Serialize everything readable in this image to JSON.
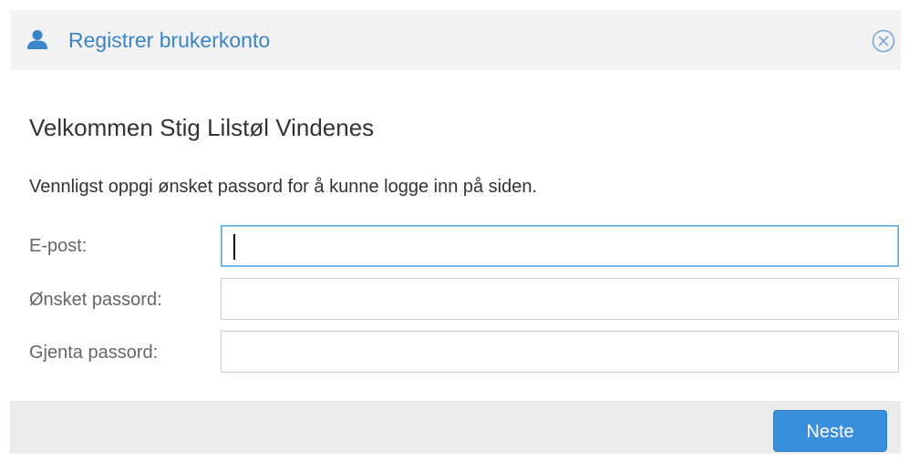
{
  "dialog": {
    "title": "Registrer brukerkonto",
    "title_icon": "user-icon",
    "close_icon": "close-circle-icon"
  },
  "main": {
    "welcome": "Velkommen Stig Lilstøl Vindenes",
    "instructions": "Vennligst oppgi ønsket passord for å kunne logge inn på siden.",
    "fields": [
      {
        "label": "E-post:",
        "value": "",
        "placeholder": "",
        "focused": true
      },
      {
        "label": "Ønsket passord:",
        "value": "",
        "placeholder": "",
        "focused": false
      },
      {
        "label": "Gjenta passord:",
        "value": "",
        "placeholder": "",
        "focused": false
      }
    ]
  },
  "footer": {
    "next_label": "Neste"
  },
  "colors": {
    "accent": "#3c84c8",
    "button": "#3a8fdc",
    "header_bg": "#f2f2f2",
    "footer_bg": "#ebebeb"
  }
}
